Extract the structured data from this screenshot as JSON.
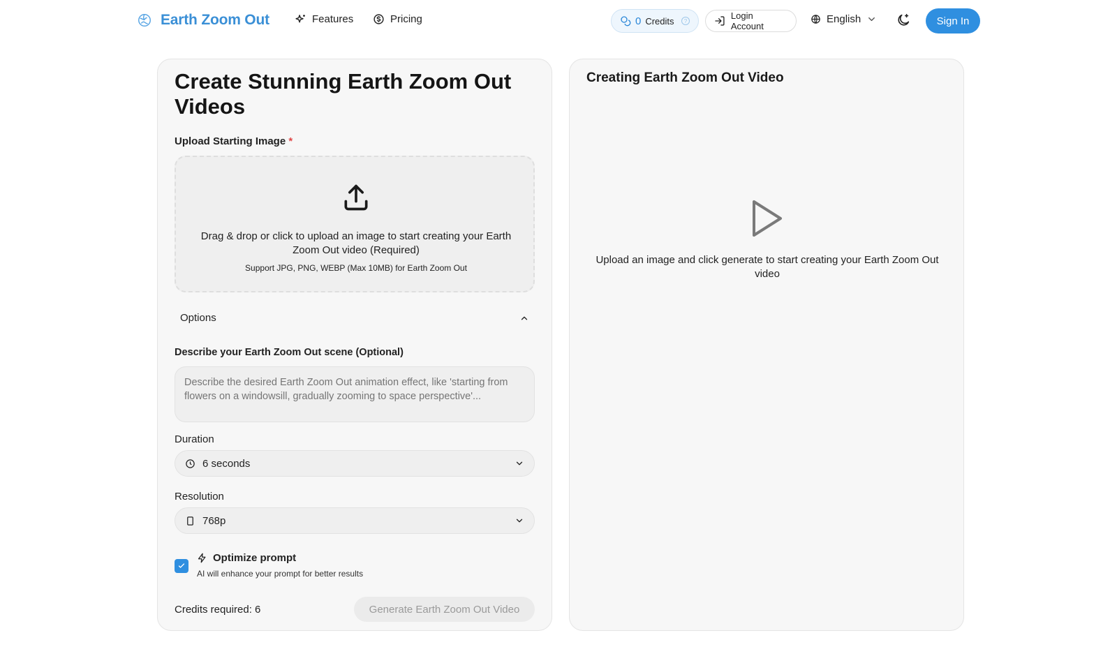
{
  "header": {
    "brand": "Earth Zoom Out",
    "nav": [
      {
        "label": "Features",
        "icon": "sparkles-icon"
      },
      {
        "label": "Pricing",
        "icon": "dollar-circle-icon"
      }
    ],
    "credits_count": "0",
    "credits_label": "Credits",
    "login_label": "Login Account",
    "language": "English",
    "signin_label": "Sign In",
    "accent_color": "#2f8fe0"
  },
  "form": {
    "title": "Create Stunning Earth Zoom Out Videos",
    "upload_label": "Upload Starting Image",
    "required_mark": "*",
    "dropzone_text": "Drag & drop or click to upload an image to start creating your Earth Zoom Out video (Required)",
    "dropzone_sub": "Support JPG, PNG, WEBP (Max 10MB) for Earth Zoom Out",
    "options_label": "Options",
    "scene_label": "Describe your Earth Zoom Out scene (Optional)",
    "scene_placeholder": "Describe the desired Earth Zoom Out animation effect, like 'starting from flowers on a windowsill, gradually zooming to space perspective'...",
    "duration_label": "Duration",
    "duration_value": "6 seconds",
    "resolution_label": "Resolution",
    "resolution_value": "768p",
    "optimize_title": "Optimize prompt",
    "optimize_sub": "AI will enhance your prompt for better results",
    "optimize_checked": true,
    "credits_required": "Credits required: 6",
    "generate_label": "Generate Earth Zoom Out Video"
  },
  "preview": {
    "title": "Creating Earth Zoom Out Video",
    "message": "Upload an image and click generate to start creating your Earth Zoom Out video"
  }
}
